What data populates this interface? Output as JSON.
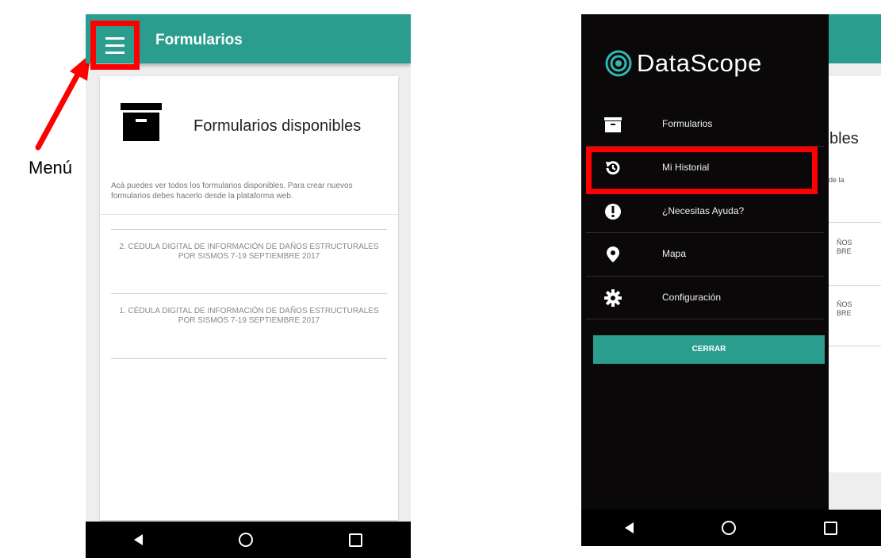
{
  "left_screen": {
    "appbar": {
      "title": "Formularios",
      "menu_icon": "hamburger-menu-icon"
    },
    "card": {
      "icon": "archive-box-icon",
      "title": "Formularios disponibles",
      "description": "Acá puedes ver todos los formularios disponibles. Para crear nuevos formularios debes hacerlo desde la plataforma web."
    },
    "forms": [
      {
        "label": "2. CÉDULA DIGITAL DE INFORMACIÓN DE DAÑOS ESTRUCTURALES POR SISMOS 7-19 SEPTIEMBRE 2017"
      },
      {
        "label": "1. CÉDULA DIGITAL DE INFORMACIÓN DE DAÑOS ESTRUCTURALES POR SISMOS 7-19 SEPTIEMBRE 2017"
      }
    ]
  },
  "annotation": {
    "menu_label": "Menú",
    "highlight_color": "#ff0000"
  },
  "right_screen": {
    "logo_text": "DataScope",
    "drawer_items": [
      {
        "label": "Formularios",
        "icon": "archive-box-icon"
      },
      {
        "label": "Mi Historial",
        "icon": "history-icon"
      },
      {
        "label": "¿Necesitas Ayuda?",
        "icon": "alert-circle-icon"
      },
      {
        "label": "Mapa",
        "icon": "map-pin-icon"
      },
      {
        "label": "Configuración",
        "icon": "gear-icon"
      }
    ],
    "close_button": "CERRAR",
    "background_fragments": {
      "title_fragment": "bles",
      "desc_fragment": "de la",
      "item1_fragment_a": "ÑOS",
      "item1_fragment_b": "BRE",
      "item2_fragment_a": "ÑOS",
      "item2_fragment_b": "BRE"
    }
  },
  "colors": {
    "teal": "#2a9d8f",
    "drawer_bg": "#0a0808",
    "nav_bar": "#000000"
  },
  "nav_bar": {
    "icons": [
      "back-icon",
      "home-icon",
      "recents-icon"
    ]
  }
}
